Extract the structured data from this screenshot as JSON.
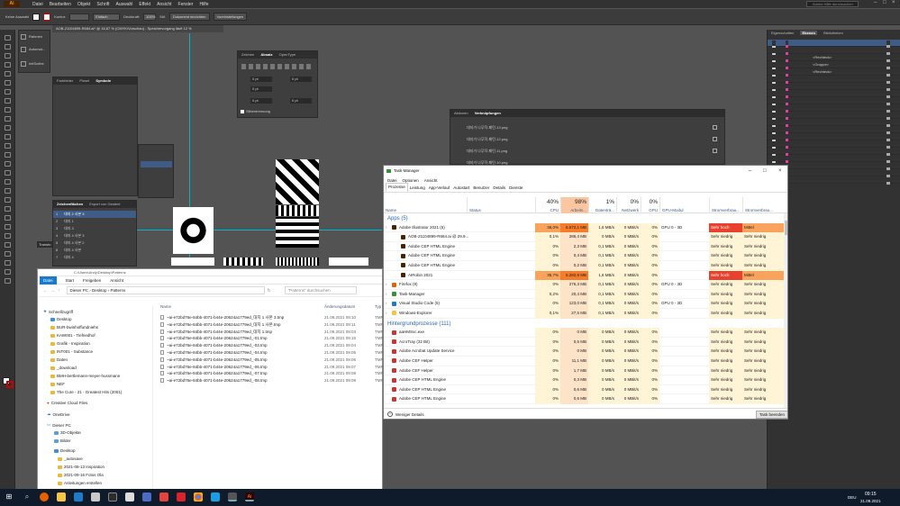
{
  "menubar": {
    "logo": "Ai",
    "items": [
      "Datei",
      "Bearbeiten",
      "Objekt",
      "Schrift",
      "Auswahl",
      "Effekt",
      "Ansicht",
      "Fenster",
      "Hilfe"
    ],
    "search_placeholder": "Adobe Hilfe durchsuchen"
  },
  "controlbar": {
    "selection": "Keine Auswahl",
    "kontur_label": "Kontur:",
    "stroke_style": "Einfach",
    "deckkraft_label": "Deckkraft:",
    "deckkraft_value": "100%",
    "stil_label": "Stil:",
    "dokument_button": "Dokument einrichten",
    "voreinstellungen_button": "Voreinstellungen"
  },
  "document_tab": "AOB-21104899-R684.ai* @ 16,67 % (CMYK/Vorschau) - Speichervorgang läuft 12 %",
  "left_float_panel": {
    "items": [
      "Farbfelder",
      "Pinsel",
      "Symbole"
    ]
  },
  "small_panel_labels": {
    "rahmen": "Rahmen",
    "automatic": "Automat...",
    "letter": "InitScribe"
  },
  "char_panel": {
    "tabs": [
      "Zeichen",
      "Absatz",
      "OpenType"
    ],
    "fields": [
      "0 pt",
      "0 pt",
      "0 pt",
      "0 pt",
      "0 pt"
    ],
    "hyphenation_label": "Silbentrennung"
  },
  "layers_float": {
    "tabs": [
      "Zeichenflächen",
      "Export von Gestent"
    ],
    "rows": [
      {
        "num": "1",
        "name": "대지 2 사본 3"
      },
      {
        "num": "2",
        "name": "대지 1"
      },
      {
        "num": "3",
        "name": "대지 3"
      },
      {
        "num": "4",
        "name": "대지 4 사본 3"
      },
      {
        "num": "5",
        "name": "대지 4 사본 2"
      },
      {
        "num": "6",
        "name": "대지 4 사본"
      },
      {
        "num": "7",
        "name": "대지 4"
      }
    ]
  },
  "links_panel": {
    "tabs": [
      "Aktionen",
      "Verknüpfungen"
    ],
    "rows": [
      "대지가 나무작-패턴-13.png",
      "대지가 나무작-패턴-12.png",
      "대지가 나무작-패턴-11.png",
      "대지가 나무작-패턴-10.png"
    ]
  },
  "right_panel": {
    "tabs": [
      "Eigenschaften",
      "Ebenen",
      "Bibliotheken"
    ],
    "sub_rows": [
      "<Rechteck>",
      "<Gruppe>",
      "<Rechteck>"
    ]
  },
  "transform_side_label": "Transfo",
  "explorer": {
    "title": "C:\\Users\\Andy\\Desktop\\Patterns",
    "ribbon": [
      "Datei",
      "Start",
      "Freigeben",
      "Ansicht"
    ],
    "path": [
      "Dieser PC",
      "Desktop",
      "Patterns"
    ],
    "search_placeholder": "\"Patterns\" durchsuchen",
    "nav": [
      {
        "label": "Schnellzugriff",
        "type": "star"
      },
      {
        "label": "Desktop",
        "type": "folder"
      },
      {
        "label": "BUR-bwinhoffundniehs",
        "type": "folder"
      },
      {
        "label": "KAW001 - Tiefriedhof",
        "type": "folder"
      },
      {
        "label": "Grafik - Inspiration",
        "type": "folder"
      },
      {
        "label": "INT001 - Substance",
        "type": "folder"
      },
      {
        "label": "Daten",
        "type": "folder"
      },
      {
        "label": "_download",
        "type": "folder"
      },
      {
        "label": "BMH-bertlemann-meyer-hussmann",
        "type": "folder"
      },
      {
        "label": "NEF",
        "type": "folder"
      },
      {
        "label": "The Cure - 21 - Greatest Hits (2001)",
        "type": "folder"
      },
      {
        "label": "Creative Cloud Files",
        "type": "cloud"
      },
      {
        "label": "OneDrive",
        "type": "cloud"
      },
      {
        "label": "Dieser PC",
        "type": "pc"
      },
      {
        "label": "3D-Objekte",
        "type": "folder"
      },
      {
        "label": "Bilder",
        "type": "folder"
      },
      {
        "label": "Desktop",
        "type": "folder"
      },
      {
        "label": "_autosave",
        "type": "folder"
      },
      {
        "label": "2021-08-13 Inspiration",
        "type": "folder"
      },
      {
        "label": "2021-09-16 Fotos Ola",
        "type": "folder"
      },
      {
        "label": "Anleitungen erstellen",
        "type": "folder"
      }
    ],
    "columns": [
      "Name",
      "Änderungsdatum",
      "Typ"
    ],
    "files": [
      {
        "name": "~ai-e72bd76e-84bb-4071-b44e-20624a1779ed_대지 1 사본 3.tmp",
        "date": "21.09.2021 09:10",
        "type": "TMP"
      },
      {
        "name": "~ai-e72bd76e-84bb-4071-b44e-20624a1779ed_대지 1 사본.tmp",
        "date": "21.09.2021 09:11",
        "type": "TMP"
      },
      {
        "name": "~ai-e72bd76e-84bb-4071-b44e-20624a1779ed_대지 1.tmp",
        "date": "21.09.2021 09:03",
        "type": "TMP"
      },
      {
        "name": "~ai-e72bd76e-84bb-4071-b44e-20624a1779ed_-01.tmp",
        "date": "21.09.2021 09:15",
        "type": "TMP"
      },
      {
        "name": "~ai-e72bd76e-84bb-4071-b44e-20624a1779ed_-03.tmp",
        "date": "21.09.2021 09:04",
        "type": "TMP"
      },
      {
        "name": "~ai-e72bd76e-84bb-4071-b44e-20624a1779ed_-04.tmp",
        "date": "21.09.2021 09:05",
        "type": "TMP"
      },
      {
        "name": "~ai-e72bd76e-84bb-4071-b44e-20624a1779ed_-05.tmp",
        "date": "21.09.2021 09:06",
        "type": "TMP"
      },
      {
        "name": "~ai-e72bd76e-84bb-4071-b44e-20624a1779ed_-06.tmp",
        "date": "21.09.2021 09:07",
        "type": "TMP"
      },
      {
        "name": "~ai-e72bd76e-84bb-4071-b44e-20624a1779ed_-07.tmp",
        "date": "21.09.2021 09:08",
        "type": "TMP"
      },
      {
        "name": "~ai-e72bd76e-84bb-4071-b44e-20624a1779ed_-08.tmp",
        "date": "21.09.2021 09:09",
        "type": "TMP"
      }
    ]
  },
  "taskmanager": {
    "title": "Task-Manager",
    "menu": [
      "Datei",
      "Optionen",
      "Ansicht"
    ],
    "tabs": [
      "Prozesse",
      "Leistung",
      "App-Verlauf",
      "Autostart",
      "Benutzer",
      "Details",
      "Dienste"
    ],
    "header": {
      "name": "Name",
      "status": "Status",
      "cpu_pct": "40%",
      "cpu": "CPU",
      "mem_pct": "98%",
      "mem": "Arbeits...",
      "disk_pct": "1%",
      "disk": "Datenträ...",
      "net_pct": "0%",
      "net": "Netzwerk",
      "gpu_pct": "0%",
      "gpu": "GPU",
      "gpumod": "GPU-Modul",
      "power": "Stromverbrau...",
      "powertrend": "Stromverbrau..."
    },
    "sections": {
      "apps": "Apps (5)",
      "background": "Hintergrundprozesse (111)"
    },
    "apps": [
      {
        "name": "Adobe Illustrator 2021 (5)",
        "cpu": "36,0%",
        "mem": "5.572,1 MB",
        "disk": "1,6 MB/s",
        "net": "0 MBit/s",
        "gpu": "0%",
        "gpumod": "GPU 0 - 3D",
        "power": "Sehr hoch",
        "trend": "Mittel",
        "level": "parent"
      },
      {
        "name": "AOB-21104899-R684.ai @ 29,9...",
        "cpu": "0,1%",
        "mem": "286,4 MB",
        "disk": "0 MB/s",
        "net": "0 MBit/s",
        "gpu": "0%",
        "gpumod": "",
        "power": "Sehr niedrig",
        "trend": "Sehr niedrig",
        "level": "child"
      },
      {
        "name": "Adobe CEP HTML Engine",
        "cpu": "0%",
        "mem": "2,3 MB",
        "disk": "0,1 MB/s",
        "net": "0 MBit/s",
        "gpu": "0%",
        "gpumod": "",
        "power": "Sehr niedrig",
        "trend": "Sehr niedrig",
        "level": "child"
      },
      {
        "name": "Adobe CEP HTML Engine",
        "cpu": "0%",
        "mem": "0,4 MB",
        "disk": "0,1 MB/s",
        "net": "0 MBit/s",
        "gpu": "0%",
        "gpumod": "",
        "power": "Sehr niedrig",
        "trend": "Sehr niedrig",
        "level": "child"
      },
      {
        "name": "Adobe CEP HTML Engine",
        "cpu": "0%",
        "mem": "0,2 MB",
        "disk": "0,1 MB/s",
        "net": "0 MBit/s",
        "gpu": "0%",
        "gpumod": "",
        "power": "Sehr niedrig",
        "trend": "Sehr niedrig",
        "level": "child"
      },
      {
        "name": "AIRobin 2021",
        "cpu": "35,7%",
        "mem": "5.282,8 MB",
        "disk": "1,6 MB/s",
        "net": "0 MBit/s",
        "gpu": "0%",
        "gpumod": "",
        "power": "Sehr hoch",
        "trend": "Mittel",
        "level": "child"
      },
      {
        "name": "Firefox (9)",
        "cpu": "0%",
        "mem": "276,3 MB",
        "disk": "0,1 MB/s",
        "net": "0 MBit/s",
        "gpu": "0%",
        "gpumod": "GPU 0 - 3D",
        "power": "Sehr niedrig",
        "trend": "Sehr niedrig",
        "level": "parent"
      },
      {
        "name": "Task-Manager",
        "cpu": "0,2%",
        "mem": "20,4 MB",
        "disk": "0,1 MB/s",
        "net": "0 MBit/s",
        "gpu": "0%",
        "gpumod": "",
        "power": "Sehr niedrig",
        "trend": "Sehr niedrig",
        "level": "parent"
      },
      {
        "name": "Visual Studio Code (5)",
        "cpu": "0%",
        "mem": "123,0 MB",
        "disk": "0,1 MB/s",
        "net": "0 MBit/s",
        "gpu": "0%",
        "gpumod": "GPU 0 - 3D",
        "power": "Sehr niedrig",
        "trend": "Sehr niedrig",
        "level": "parent"
      },
      {
        "name": "Windows-Explorer",
        "cpu": "0,1%",
        "mem": "27,5 MB",
        "disk": "0,1 MB/s",
        "net": "0 MBit/s",
        "gpu": "0%",
        "gpumod": "",
        "power": "Sehr niedrig",
        "trend": "Sehr niedrig",
        "level": "parent"
      }
    ],
    "background": [
      {
        "name": "aaHMSvc.exe",
        "cpu": "0%",
        "mem": "0 MB",
        "disk": "0 MB/s",
        "net": "0 MBit/s",
        "gpu": "0%",
        "power": "Sehr niedrig",
        "trend": "Sehr niedrig"
      },
      {
        "name": "AcroTray (32 Bit)",
        "cpu": "0%",
        "mem": "0,5 MB",
        "disk": "0 MB/s",
        "net": "0 MBit/s",
        "gpu": "0%",
        "power": "Sehr niedrig",
        "trend": "Sehr niedrig"
      },
      {
        "name": "Adobe Acrobat Update Service",
        "cpu": "0%",
        "mem": "0 MB",
        "disk": "0 MB/s",
        "net": "0 MBit/s",
        "gpu": "0%",
        "power": "Sehr niedrig",
        "trend": "Sehr niedrig"
      },
      {
        "name": "Adobe CEF Helper",
        "cpu": "0%",
        "mem": "11,1 MB",
        "disk": "0 MB/s",
        "net": "0 MBit/s",
        "gpu": "0%",
        "power": "Sehr niedrig",
        "trend": "Sehr niedrig"
      },
      {
        "name": "Adobe CEF Helper",
        "cpu": "0%",
        "mem": "1,7 MB",
        "disk": "0 MB/s",
        "net": "0 MBit/s",
        "gpu": "0%",
        "power": "Sehr niedrig",
        "trend": "Sehr niedrig"
      },
      {
        "name": "Adobe CEP HTML Engine",
        "cpu": "0%",
        "mem": "0,3 MB",
        "disk": "0 MB/s",
        "net": "0 MBit/s",
        "gpu": "0%",
        "power": "Sehr niedrig",
        "trend": "Sehr niedrig"
      },
      {
        "name": "Adobe CEP HTML Engine",
        "cpu": "0%",
        "mem": "0,6 MB",
        "disk": "0 MB/s",
        "net": "0 MBit/s",
        "gpu": "0%",
        "power": "Sehr niedrig",
        "trend": "Sehr niedrig"
      },
      {
        "name": "Adobe CEP HTML Engine",
        "cpu": "0%",
        "mem": "0,6 MB",
        "disk": "0 MB/s",
        "net": "0 MBit/s",
        "gpu": "0%",
        "power": "Sehr niedrig",
        "trend": "Sehr niedrig"
      }
    ],
    "footer": {
      "less": "Weniger Details",
      "end": "Task beenden"
    }
  },
  "taskbar": {
    "time": "09:15",
    "date": "21.09.2021",
    "lang": "DEU"
  },
  "colors": {
    "accent": "#1979ca",
    "cpu_high": "#f57c2a",
    "mem_high": "#fbbd8a",
    "row_tint": "#fff4d6"
  }
}
